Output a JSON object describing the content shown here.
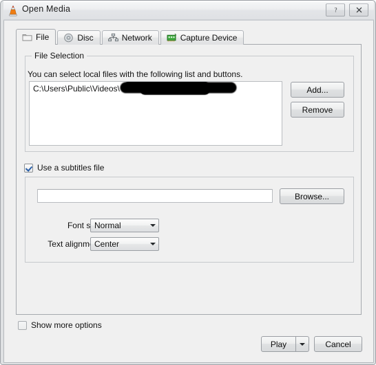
{
  "window": {
    "title": "Open Media",
    "icon": "vlc-cone-icon",
    "help_button": "?",
    "close_button": "✕"
  },
  "tabs": [
    {
      "id": "file",
      "label": "File",
      "icon": "folder-icon",
      "active": true
    },
    {
      "id": "disc",
      "label": "Disc",
      "icon": "disc-icon",
      "active": false
    },
    {
      "id": "network",
      "label": "Network",
      "icon": "network-icon",
      "active": false
    },
    {
      "id": "capture",
      "label": "Capture Device",
      "icon": "capture-card-icon",
      "active": false
    }
  ],
  "file_selection": {
    "group_title": "File Selection",
    "description": "You can select local files with the following list and buttons.",
    "list_items": [
      {
        "text": "C:\\Users\\Public\\Videos\\",
        "redacted": true
      }
    ],
    "add_button": "Add...",
    "remove_button": "Remove"
  },
  "subtitles": {
    "checkbox_label": "Use a subtitles file",
    "checked": true,
    "file_value": "",
    "file_placeholder": "",
    "browse_button": "Browse...",
    "font_size_label": "Font size:",
    "font_size_value": "Normal",
    "text_alignment_label": "Text alignment:",
    "text_alignment_value": "Center"
  },
  "footer": {
    "show_more_label": "Show more options",
    "show_more_checked": false,
    "play_button": "Play",
    "play_dropdown_icon": "caret-down-icon",
    "cancel_button": "Cancel"
  },
  "colors": {
    "dialog_bg": "#f0f0f0",
    "field_bg": "#ffffff",
    "border": "#a5a9ae",
    "accent_check": "#2a5fa8",
    "vlc_orange": "#e8720a"
  }
}
